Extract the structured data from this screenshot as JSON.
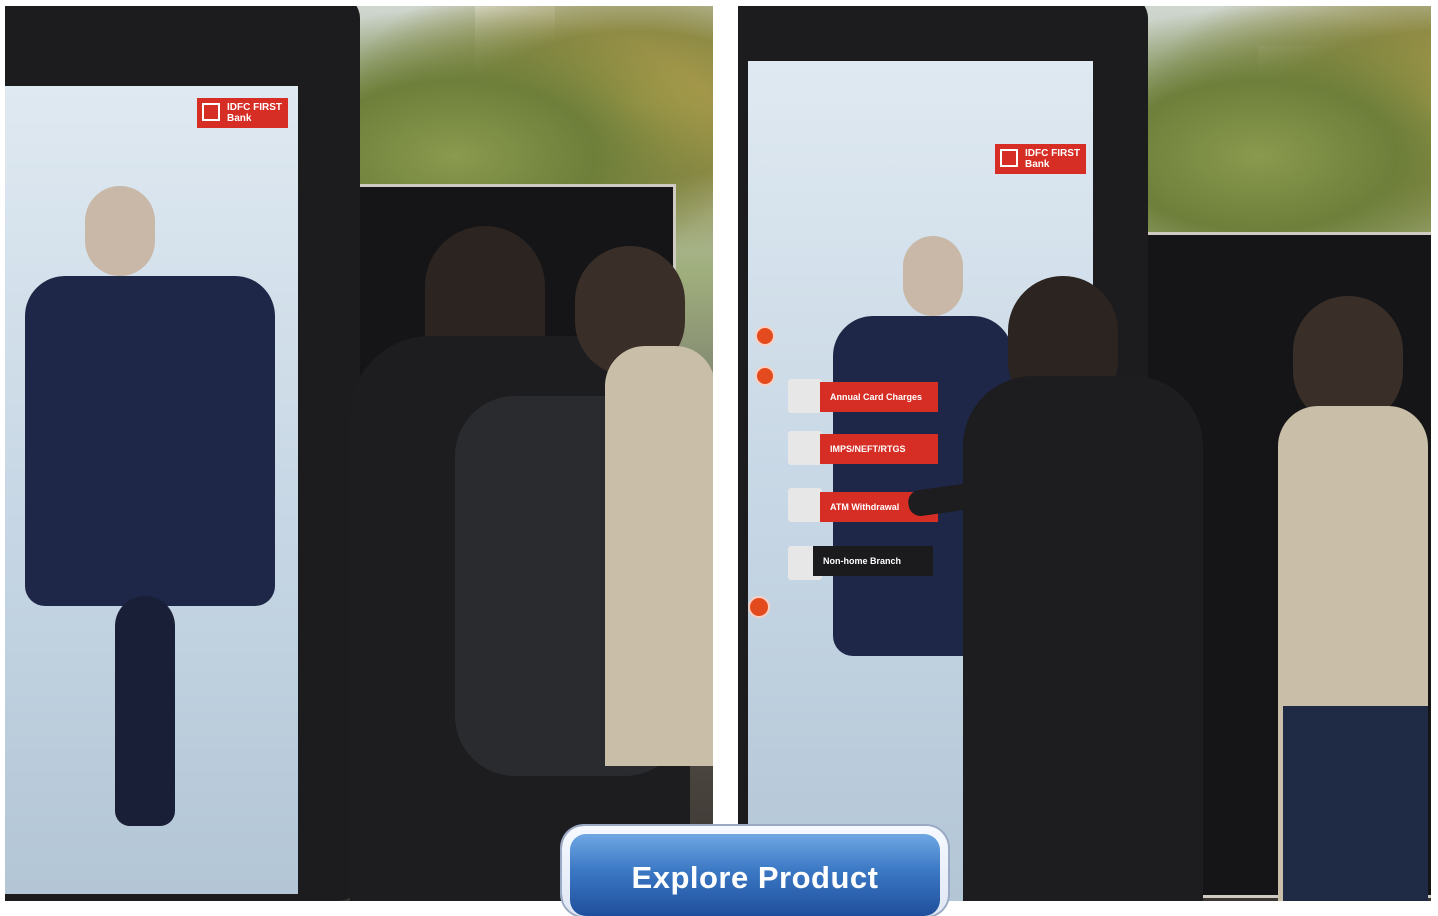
{
  "panels": {
    "left": {
      "kiosk_logo": {
        "line1": "IDFC FIRST",
        "line2": "Bank"
      }
    },
    "right": {
      "kiosk_logo": {
        "line1": "IDFC FIRST",
        "line2": "Bank"
      },
      "menu_options": [
        {
          "label": "Annual Card Charges"
        },
        {
          "label": "IMPS/NEFT/RTGS"
        },
        {
          "label": "ATM Withdrawal"
        },
        {
          "label": "Non-home Branch"
        }
      ]
    }
  },
  "cta": {
    "label": "Explore Product"
  },
  "colors": {
    "brand_red": "#d62e25",
    "cta_blue": "#2f66b3"
  }
}
